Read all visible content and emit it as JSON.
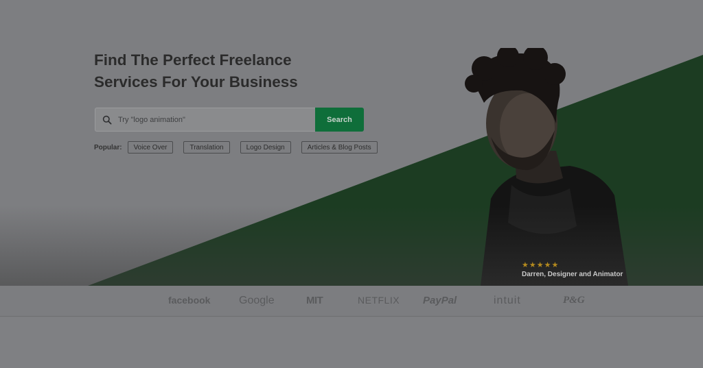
{
  "hero": {
    "headline_line1": "Find The Perfect Freelance",
    "headline_line2": "Services For Your Business",
    "search": {
      "placeholder": "Try \"logo animation\"",
      "button_label": "Search"
    },
    "popular": {
      "label": "Popular:",
      "tags": [
        "Voice Over",
        "Translation",
        "Logo Design",
        "Articles & Blog Posts"
      ]
    },
    "testimonial": {
      "stars": "★★★★★",
      "caption": "Darren, Designer and Animator"
    }
  },
  "trusted_by": {
    "logos": [
      "facebook",
      "Google",
      "MIT",
      "NETFLIX",
      "PayPal",
      "intuit",
      "P&G"
    ]
  },
  "colors": {
    "accent_green": "#0f6e3a",
    "overlay_green": "#1d3f23",
    "star": "#b48a1e"
  }
}
